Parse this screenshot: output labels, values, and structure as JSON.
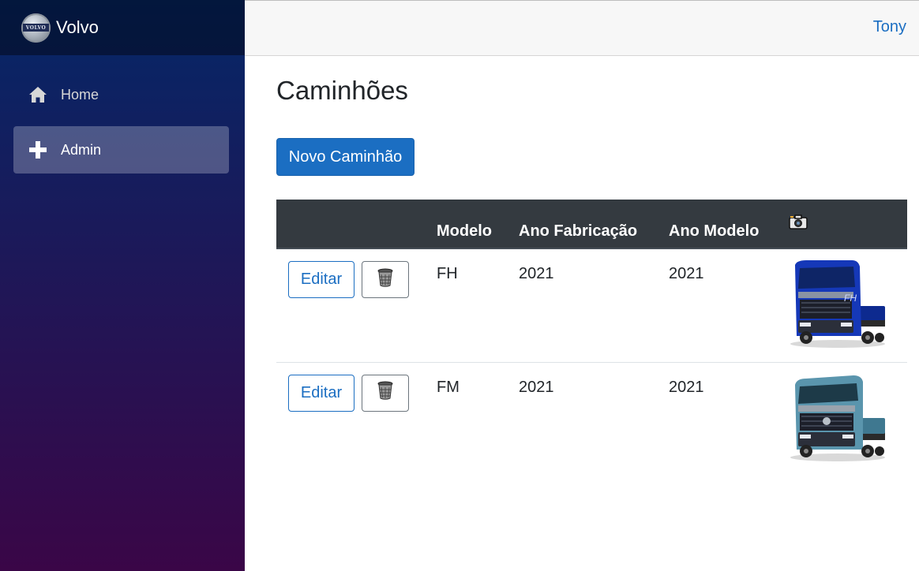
{
  "sidebar": {
    "brand": "Volvo",
    "logo_text": "VOLVO",
    "items": [
      {
        "label": "Home",
        "icon": "home-icon"
      },
      {
        "label": "Admin",
        "icon": "plus-icon",
        "active": true
      }
    ]
  },
  "topbar": {
    "user": "Tony"
  },
  "main": {
    "title": "Caminhões",
    "new_button": "Novo Caminhão",
    "table": {
      "headers": [
        "",
        "Modelo",
        "Ano Fabricação",
        "Ano Modelo"
      ],
      "photo_header_icon": "camera-icon",
      "rows": [
        {
          "edit": "Editar",
          "delete_icon": "trash-icon",
          "modelo": "FH",
          "ano_fabricacao": "2021",
          "ano_modelo": "2021",
          "cab_color": "#1538b8"
        },
        {
          "edit": "Editar",
          "delete_icon": "trash-icon",
          "modelo": "FM",
          "ano_fabricacao": "2021",
          "ano_modelo": "2021",
          "cab_color": "#5a95ad"
        }
      ]
    }
  },
  "colors": {
    "primary": "#1b6ec2",
    "table_header": "#343a40",
    "sidebar_top": "#052767",
    "sidebar_bottom": "#3a0647"
  }
}
